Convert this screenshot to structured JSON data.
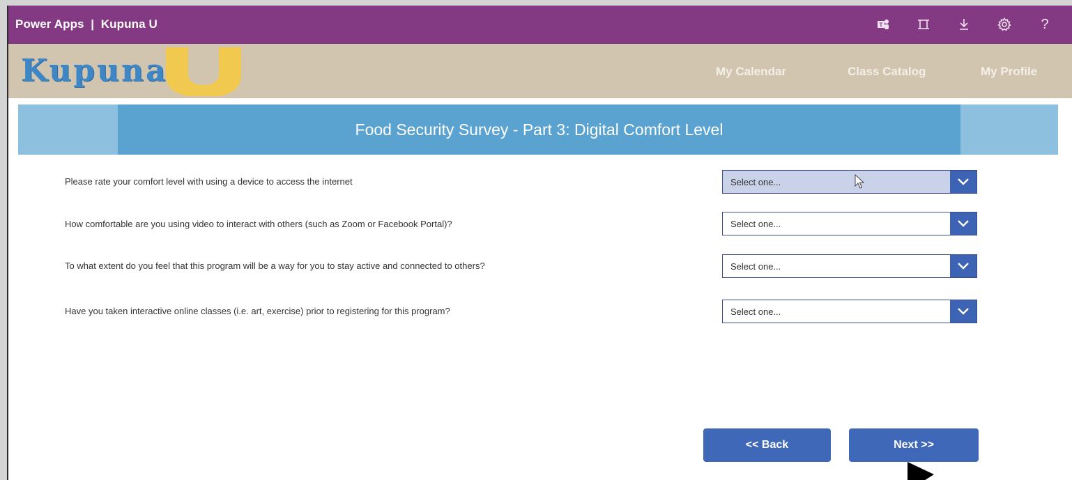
{
  "app_bar": {
    "title": "Power Apps  |  Kupuna U",
    "icons": [
      "teams-icon",
      "fit-screen-icon",
      "download-icon",
      "settings-icon",
      "help-icon"
    ],
    "help_glyph": "?"
  },
  "header": {
    "logo_text": "Kupuna",
    "logo_accent_letter": "U",
    "nav": [
      "My Calendar",
      "Class Catalog",
      "My Profile"
    ]
  },
  "banner": {
    "title": "Food Security Survey - Part 3: Digital Comfort Level"
  },
  "questions": [
    {
      "text": "Please rate your comfort level with using a device to access the internet",
      "selected": "Select one..."
    },
    {
      "text": "How comfortable are you using video to interact with others (such as Zoom or Facebook Portal)?",
      "selected": "Select one..."
    },
    {
      "text": "To what extent do you feel that this program will be a way for you to stay active and connected to others?",
      "selected": "Select one..."
    },
    {
      "text": "Have you taken interactive online classes (i.e. art, exercise) prior to registering for this program?",
      "selected": "Select one..."
    }
  ],
  "buttons": {
    "back": "<< Back",
    "next": "Next >>"
  },
  "colors": {
    "app_bar": "#843a82",
    "header": "#d2c5b0",
    "banner_outer": "#8dbfde",
    "banner_inner": "#5aa3d1",
    "button": "#3f69b8",
    "dropdown_arrow": "#3d63b4",
    "logo_blue": "#3f86c5",
    "logo_yellow": "#f3c94a"
  }
}
